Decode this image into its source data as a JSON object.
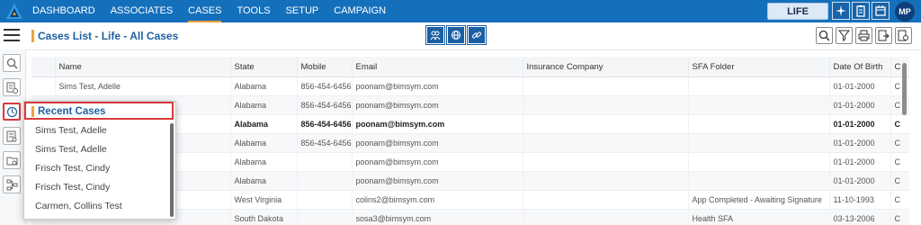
{
  "nav": {
    "items": [
      {
        "label": "DASHBOARD",
        "active": false
      },
      {
        "label": "ASSOCIATES",
        "active": false
      },
      {
        "label": "CASES",
        "active": true
      },
      {
        "label": "TOOLS",
        "active": false
      },
      {
        "label": "SETUP",
        "active": false
      },
      {
        "label": "CAMPAIGN",
        "active": false
      }
    ],
    "product_label": "LIFE",
    "avatar_initials": "MP",
    "accent_color": "#1570bc",
    "active_underline_color": "#f0a23a"
  },
  "header": {
    "title": "Cases List - Life - All Cases"
  },
  "table": {
    "columns": [
      "Name",
      "State",
      "Mobile",
      "Email",
      "Insurance Company",
      "SFA Folder",
      "Date Of Birth",
      "C"
    ],
    "rows": [
      {
        "name": "Sims Test, Adelle",
        "state": "Alabama",
        "mobile": "856-454-6456",
        "email": "poonam@bimsym.com",
        "insurance": "",
        "sfa": "",
        "dob": "01-01-2000",
        "c": "C",
        "bold": false
      },
      {
        "name": "",
        "state": "Alabama",
        "mobile": "856-454-6456",
        "email": "poonam@bimsym.com",
        "insurance": "",
        "sfa": "",
        "dob": "01-01-2000",
        "c": "C",
        "bold": false
      },
      {
        "name": "",
        "state": "Alabama",
        "mobile": "856-454-6456",
        "email": "poonam@bimsym.com",
        "insurance": "",
        "sfa": "",
        "dob": "01-01-2000",
        "c": "C",
        "bold": true
      },
      {
        "name": "",
        "state": "Alabama",
        "mobile": "856-454-6456",
        "email": "poonam@bimsym.com",
        "insurance": "",
        "sfa": "",
        "dob": "01-01-2000",
        "c": "C",
        "bold": false
      },
      {
        "name": "",
        "state": "Alabama",
        "mobile": "",
        "email": "poonam@bimsym.com",
        "insurance": "",
        "sfa": "",
        "dob": "01-01-2000",
        "c": "C",
        "bold": false
      },
      {
        "name": "",
        "state": "Alabama",
        "mobile": "",
        "email": "poonam@bimsym.com",
        "insurance": "",
        "sfa": "",
        "dob": "01-01-2000",
        "c": "C",
        "bold": false
      },
      {
        "name": "",
        "state": "West Virginia",
        "mobile": "",
        "email": "colins2@bimsym.com",
        "insurance": "",
        "sfa": "App Completed - Awaiting Signature",
        "dob": "11-10-1993",
        "c": "C",
        "bold": false
      },
      {
        "name": "",
        "state": "South Dakota",
        "mobile": "",
        "email": "sosa3@bimsym.com",
        "insurance": "",
        "sfa": "Health SFA",
        "dob": "03-13-2006",
        "c": "C",
        "bold": false
      }
    ]
  },
  "recent_cases": {
    "title": "Recent Cases",
    "items": [
      "Sims Test, Adelle",
      "Sims Test, Adelle",
      "Frisch Test, Cindy",
      "Frisch Test, Cindy",
      "Carmen, Collins Test"
    ]
  },
  "icons": {
    "rail": [
      "search-icon",
      "add-list-icon",
      "recent-clock-icon",
      "report-icon",
      "folder-icon",
      "workflow-icon"
    ],
    "view_toggle": [
      "users-view-icon",
      "globe-view-icon",
      "link-view-icon"
    ],
    "tools": [
      "search-icon",
      "filter-icon",
      "print-icon",
      "export-icon",
      "settings-icon"
    ],
    "top": [
      "sparkle-icon",
      "clipboard-icon",
      "calendar-icon"
    ]
  }
}
